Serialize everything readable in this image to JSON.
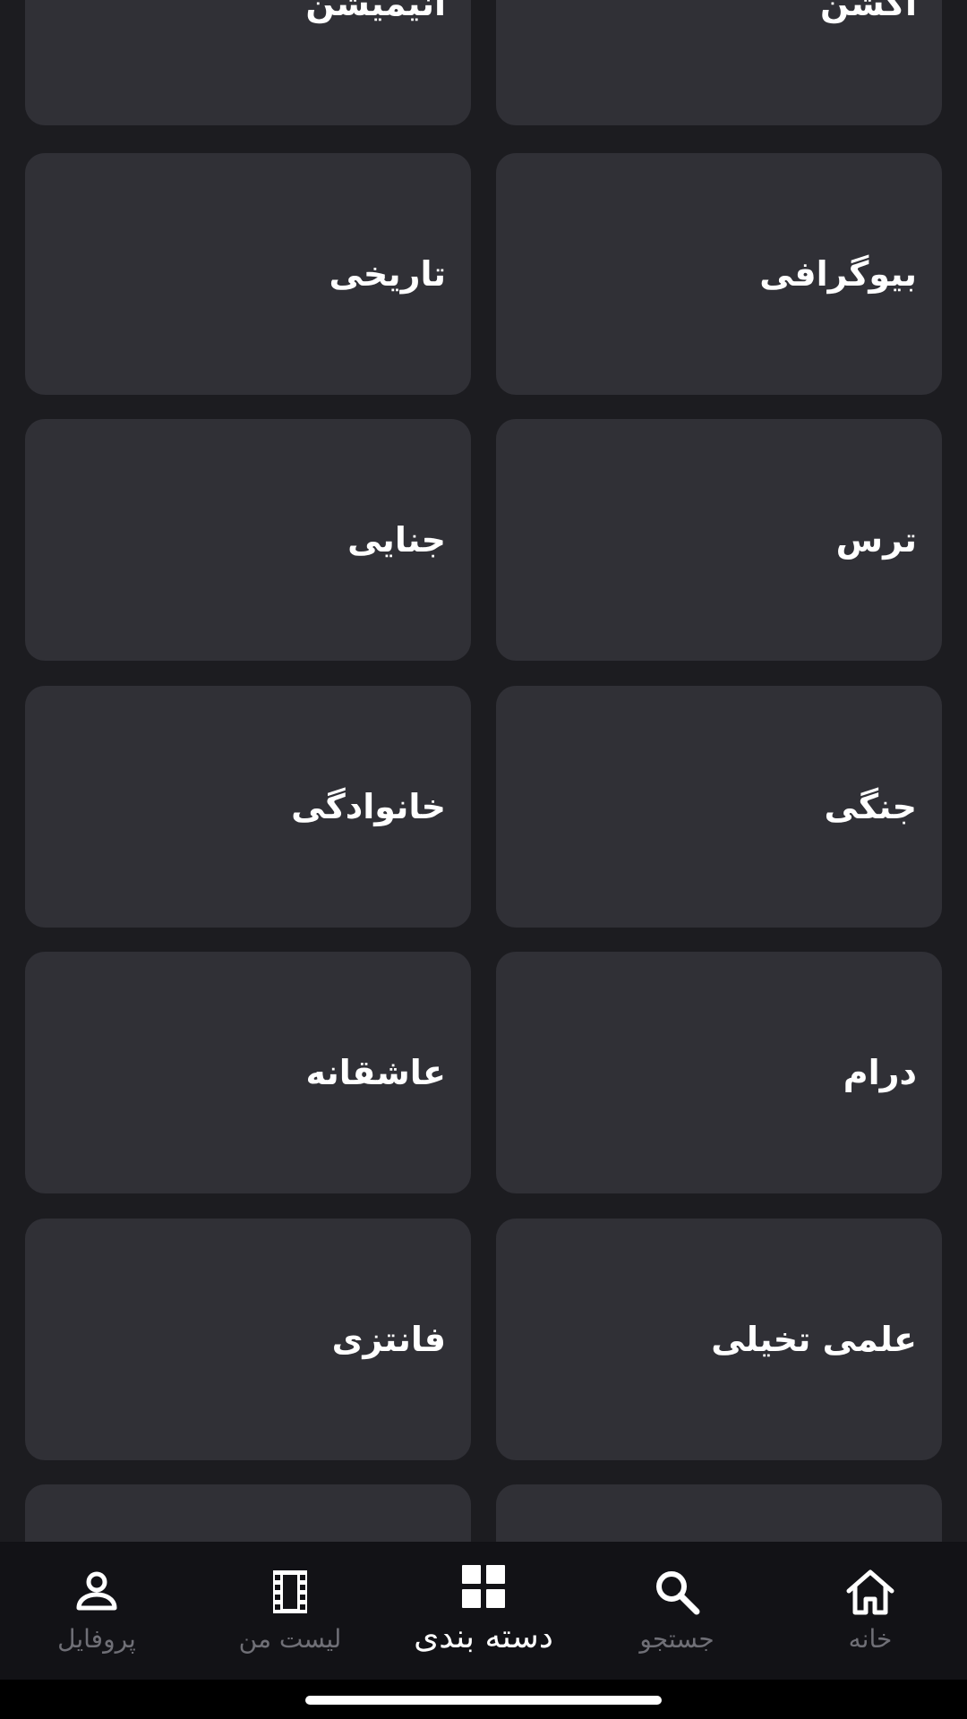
{
  "categories": [
    {
      "label": "اکشن"
    },
    {
      "label": "انیمیشن"
    },
    {
      "label": "بیوگرافی"
    },
    {
      "label": "تاریخی"
    },
    {
      "label": "ترس"
    },
    {
      "label": "جنایی"
    },
    {
      "label": "جنگی"
    },
    {
      "label": "خانوادگی"
    },
    {
      "label": "درام"
    },
    {
      "label": "عاشقانه"
    },
    {
      "label": "علمی تخیلی"
    },
    {
      "label": "فانتزی"
    },
    {
      "label": ""
    },
    {
      "label": ""
    }
  ],
  "nav": {
    "items": [
      {
        "label": "خانه",
        "icon": "home-icon"
      },
      {
        "label": "جستجو",
        "icon": "search-icon"
      },
      {
        "label": "دسته بندی",
        "icon": "grid-icon",
        "active": true
      },
      {
        "label": "لیست من",
        "icon": "film-icon"
      },
      {
        "label": "پروفایل",
        "icon": "profile-icon"
      }
    ]
  },
  "colors": {
    "background": "#1c1c20",
    "card": "#303036",
    "nav_background": "#121216",
    "nav_inactive": "#6f6f76",
    "nav_active": "#ffffff"
  }
}
